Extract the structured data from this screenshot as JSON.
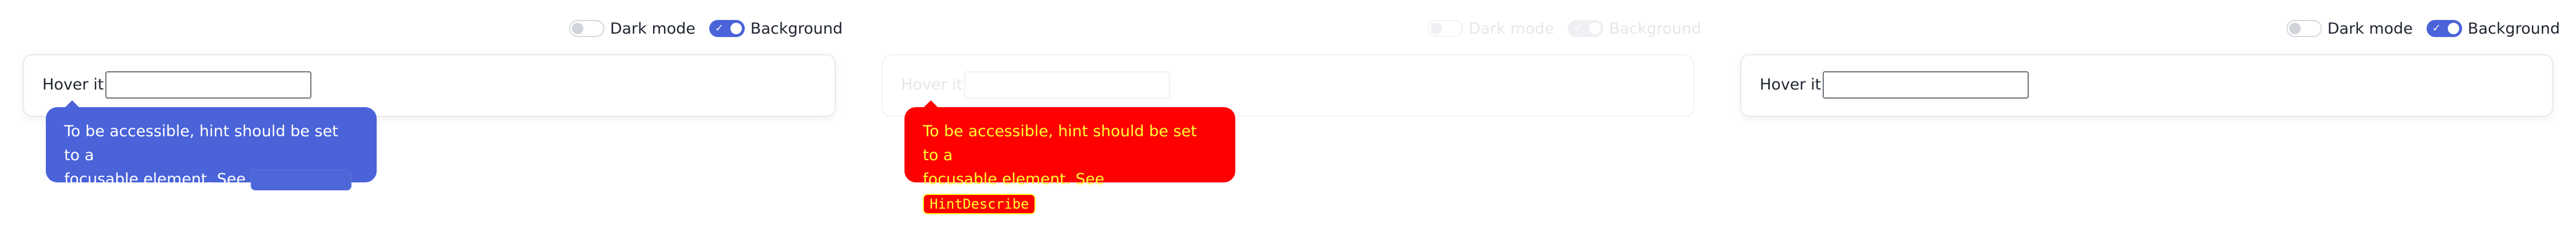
{
  "controls": {
    "dark_mode_label": "Dark mode",
    "background_label": "Background",
    "dark_mode_on": false,
    "background_on": true
  },
  "demo": {
    "hover_label": "Hover it!",
    "input_value": ""
  },
  "hint": {
    "text_line1": "To be accessible, hint should be set to a",
    "text_line2": "focusable element. See ",
    "code_link": "HintDescribe"
  },
  "colors": {
    "accent": "#4a63d9",
    "error_bg": "#ff0000",
    "error_text": "#ffff33"
  }
}
